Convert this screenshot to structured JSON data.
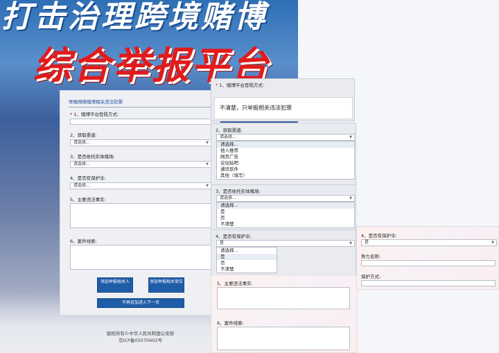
{
  "poster": {
    "title_top": "打击治理跨境赌博",
    "title_main": "综合举报平台"
  },
  "form": {
    "heading": "举报网络赌博相关违法犯罪",
    "q1_label": "1、赌博平台登陆方式:",
    "q2_label": "2、获取渠道:",
    "q2_value": "请选择...",
    "q3_label": "3、是否依托实体赌场:",
    "q3_value": "请选择...",
    "q4_label": "4、是否有保护伞:",
    "q4_value": "请选择...",
    "q5_label": "5、主要违法事实:",
    "q6_label": "6、案件线索:",
    "btn_add_person": "添加举报相关人",
    "btn_add_unit": "添加举报相关单位",
    "btn_next": "不再追加进入下一页",
    "required_mark": "*"
  },
  "footer": {
    "line1": "版权所有©中华人民共和国公安部",
    "line2": "京ICP备05070602号"
  },
  "overlay1": {
    "label": "1、赌博平台登陆方式:",
    "popup_text": "不清楚，只举报相关违法犯罪"
  },
  "overlay2": {
    "label": "2、获取渠道:",
    "selected": "请选择...",
    "options": [
      "请选择...",
      "他人推荐",
      "网页广告",
      "论坛贴吧",
      "通讯软件",
      "其他（填写）"
    ]
  },
  "overlay3": {
    "label": "3、是否依托实体赌场:",
    "selected": "请选择...",
    "options": [
      "请选择...",
      "是",
      "否",
      "不清楚"
    ]
  },
  "overlay4": {
    "label": "4、是否有保护伞:",
    "selected": "是",
    "options": [
      "请选择...",
      "是",
      "否",
      "不清楚"
    ]
  },
  "overlay5": {
    "q5_label": "5、主要违法事实:",
    "q6_label": "6、案件线索:"
  },
  "overlay6": {
    "label": "4、是否有保护伞:",
    "selected": "是",
    "force_label": "势力名称:",
    "protect_label": "保护方式:"
  }
}
